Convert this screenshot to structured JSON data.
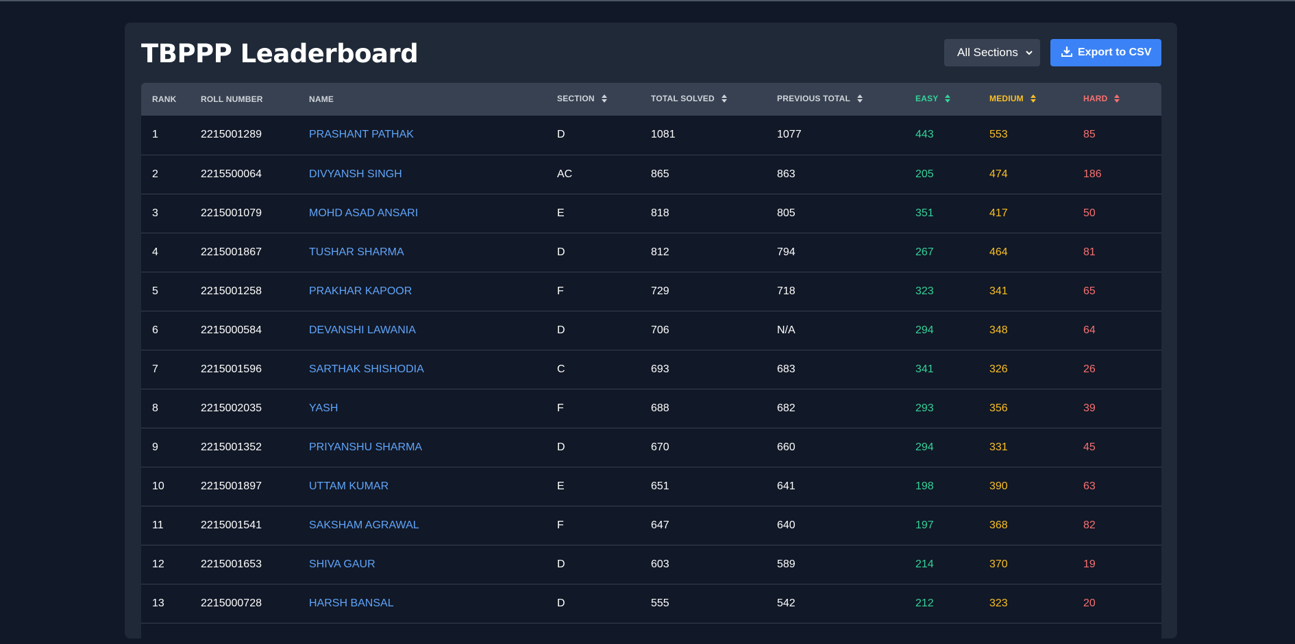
{
  "page": {
    "title": "TBPPP Leaderboard"
  },
  "controls": {
    "section_filter": "All Sections",
    "export_label": "Export to CSV"
  },
  "colors": {
    "easy": "#34d399",
    "medium": "#fbbf24",
    "hard": "#f87171",
    "link": "#60a5fa",
    "accent": "#3b82f6"
  },
  "table": {
    "headers": {
      "rank": "RANK",
      "roll": "ROLL NUMBER",
      "name": "NAME",
      "section": "SECTION",
      "total": "TOTAL SOLVED",
      "previous": "PREVIOUS TOTAL",
      "easy": "EASY",
      "medium": "MEDIUM",
      "hard": "HARD"
    },
    "rows": [
      [
        "1",
        "2215001289",
        "PRASHANT PATHAK",
        "D",
        "1081",
        "1077",
        "443",
        "553",
        "85"
      ],
      [
        "2",
        "2215500064",
        "DIVYANSH SINGH",
        "AC",
        "865",
        "863",
        "205",
        "474",
        "186"
      ],
      [
        "3",
        "2215001079",
        "MOHD ASAD ANSARI",
        "E",
        "818",
        "805",
        "351",
        "417",
        "50"
      ],
      [
        "4",
        "2215001867",
        "TUSHAR SHARMA",
        "D",
        "812",
        "794",
        "267",
        "464",
        "81"
      ],
      [
        "5",
        "2215001258",
        "PRAKHAR KAPOOR",
        "F",
        "729",
        "718",
        "323",
        "341",
        "65"
      ],
      [
        "6",
        "2215000584",
        "DEVANSHI LAWANIA",
        "D",
        "706",
        "N/A",
        "294",
        "348",
        "64"
      ],
      [
        "7",
        "2215001596",
        "SARTHAK SHISHODIA",
        "C",
        "693",
        "683",
        "341",
        "326",
        "26"
      ],
      [
        "8",
        "2215002035",
        "YASH",
        "F",
        "688",
        "682",
        "293",
        "356",
        "39"
      ],
      [
        "9",
        "2215001352",
        "PRIYANSHU SHARMA",
        "D",
        "670",
        "660",
        "294",
        "331",
        "45"
      ],
      [
        "10",
        "2215001897",
        "UTTAM KUMAR",
        "E",
        "651",
        "641",
        "198",
        "390",
        "63"
      ],
      [
        "11",
        "2215001541",
        "SAKSHAM AGRAWAL",
        "F",
        "647",
        "640",
        "197",
        "368",
        "82"
      ],
      [
        "12",
        "2215001653",
        "SHIVA GAUR",
        "D",
        "603",
        "589",
        "214",
        "370",
        "19"
      ],
      [
        "13",
        "2215000728",
        "HARSH BANSAL",
        "D",
        "555",
        "542",
        "212",
        "323",
        "20"
      ]
    ]
  }
}
